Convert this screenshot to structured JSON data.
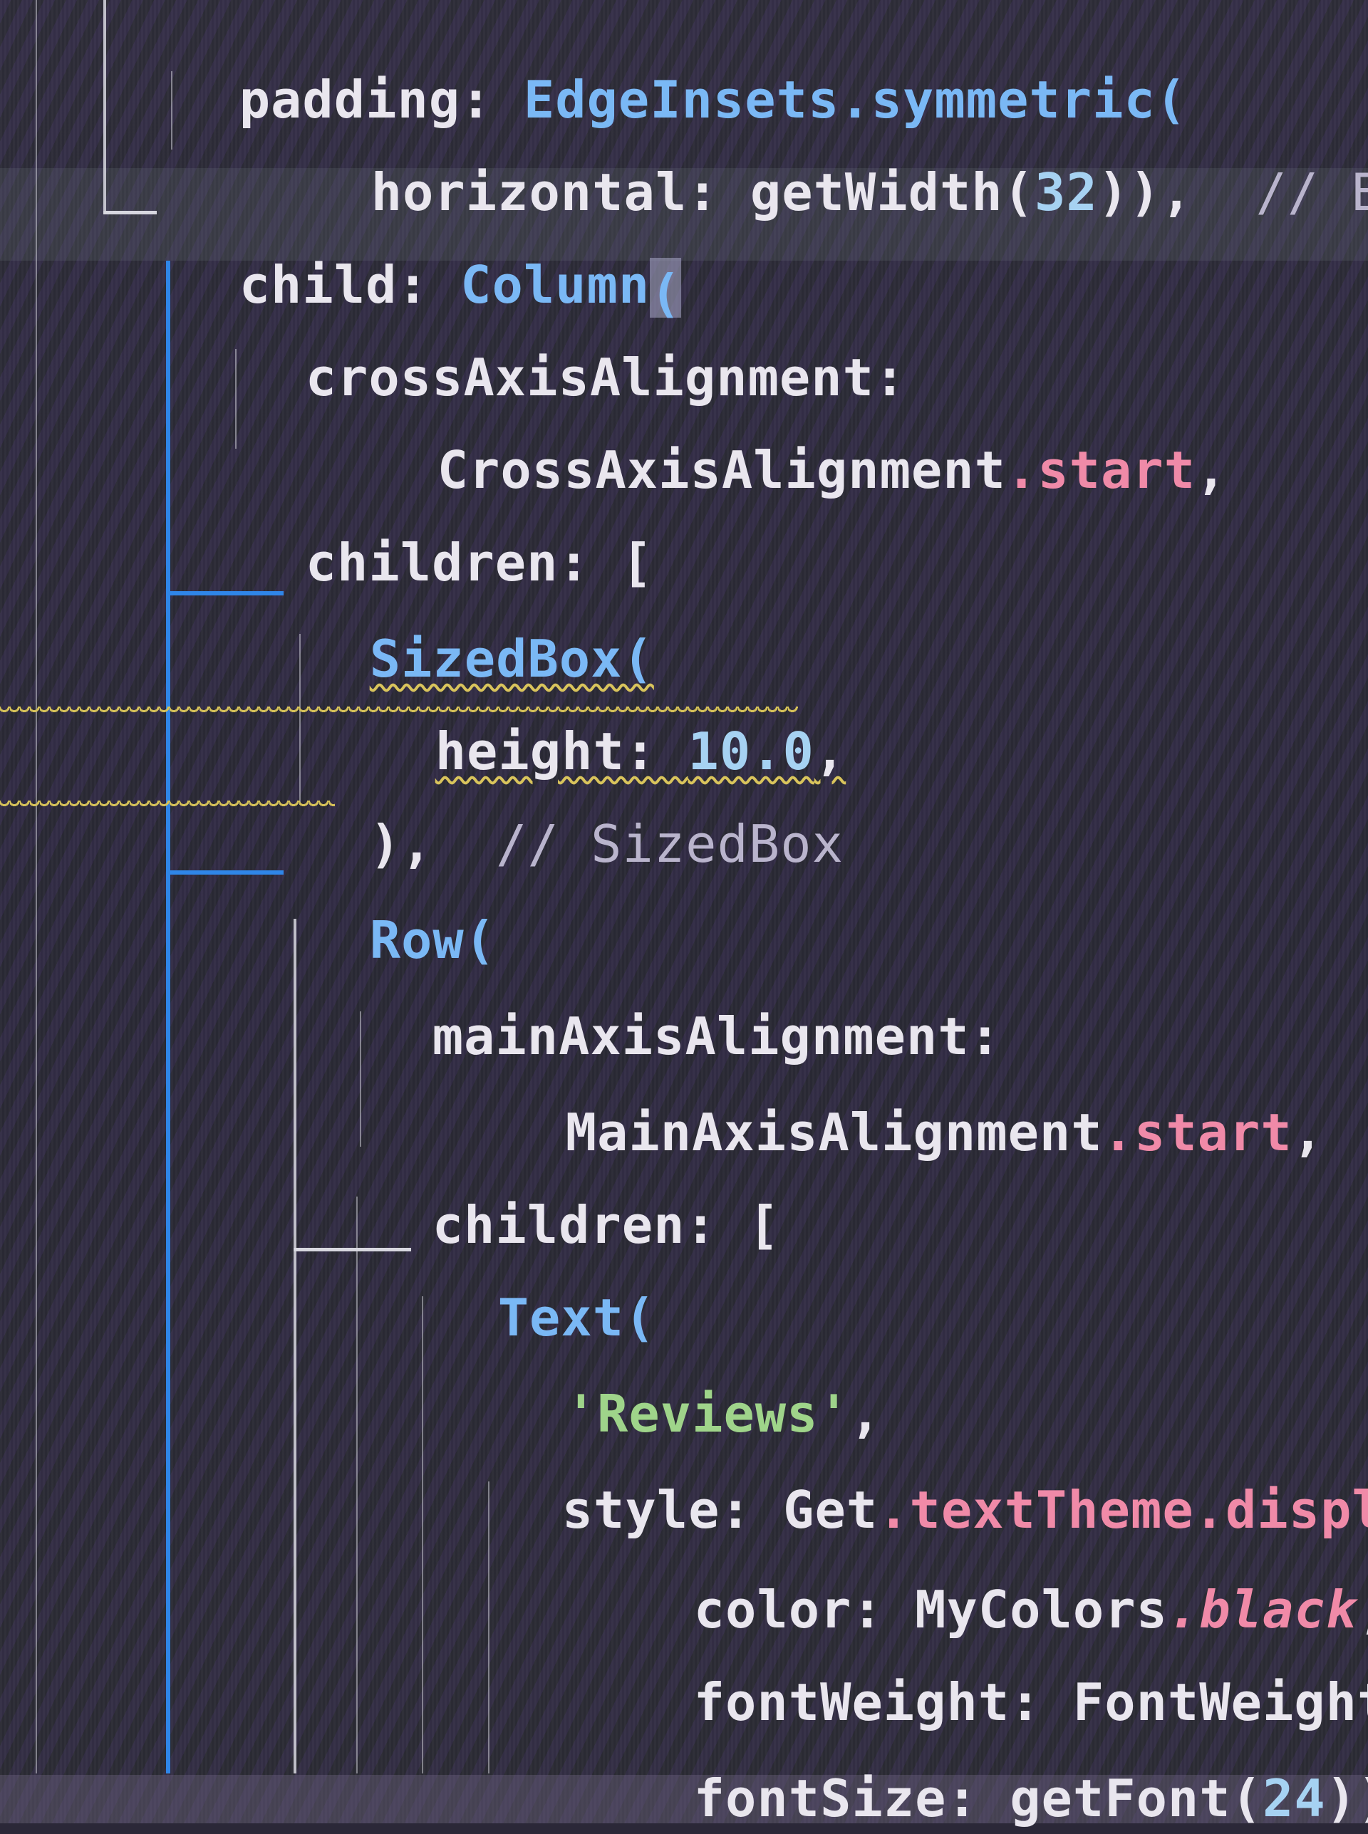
{
  "editor": {
    "language": "dart",
    "current_line_index": 2,
    "colors": {
      "background": "#2b2838",
      "keyword_class": "#7ab8f5",
      "property": "#e9e6ee",
      "number": "#a6d2f2",
      "string": "#9fd48a",
      "field": "#f08aa8",
      "comment": "#b9b4cc",
      "guide_active": "#2f86e8",
      "warning_squiggle": "#d6c259"
    },
    "lines": [
      {
        "tokens": [
          {
            "t": "padding: ",
            "k": "prop"
          },
          {
            "t": "EdgeInsets",
            "k": "class"
          },
          {
            "t": ".symmetric(",
            "k": "class"
          }
        ]
      },
      {
        "tokens": [
          {
            "t": "horizontal: ",
            "k": "prop"
          },
          {
            "t": "getWidth(",
            "k": "fn"
          },
          {
            "t": "32",
            "k": "num"
          },
          {
            "t": ")),  ",
            "k": "fn"
          },
          {
            "t": "// E",
            "k": "comment"
          }
        ]
      },
      {
        "tokens": [
          {
            "t": "child: ",
            "k": "prop"
          },
          {
            "t": "Column",
            "k": "class"
          },
          {
            "t": "(",
            "k": "class"
          }
        ]
      },
      {
        "tokens": [
          {
            "t": "crossAxisAlignment:",
            "k": "prop"
          }
        ]
      },
      {
        "tokens": [
          {
            "t": "CrossAxisAlignment",
            "k": "prop"
          },
          {
            "t": ".start",
            "k": "field"
          },
          {
            "t": ",",
            "k": "prop"
          }
        ]
      },
      {
        "tokens": [
          {
            "t": "children: [",
            "k": "prop"
          }
        ]
      },
      {
        "tokens": [
          {
            "t": "SizedBox(",
            "k": "class"
          }
        ]
      },
      {
        "tokens": [
          {
            "t": "height: ",
            "k": "prop"
          },
          {
            "t": "10.0",
            "k": "num"
          },
          {
            "t": ",",
            "k": "prop"
          }
        ]
      },
      {
        "tokens": [
          {
            "t": "),  ",
            "k": "prop"
          },
          {
            "t": "// SizedBox",
            "k": "comment"
          }
        ]
      },
      {
        "tokens": [
          {
            "t": "Row(",
            "k": "class"
          }
        ]
      },
      {
        "tokens": [
          {
            "t": "mainAxisAlignment:",
            "k": "prop"
          }
        ]
      },
      {
        "tokens": [
          {
            "t": "MainAxisAlignment",
            "k": "prop"
          },
          {
            "t": ".start",
            "k": "field"
          },
          {
            "t": ",",
            "k": "prop"
          }
        ]
      },
      {
        "tokens": [
          {
            "t": "children: [",
            "k": "prop"
          }
        ]
      },
      {
        "tokens": [
          {
            "t": "Text(",
            "k": "class"
          }
        ]
      },
      {
        "tokens": [
          {
            "t": "'Reviews'",
            "k": "string"
          },
          {
            "t": ",",
            "k": "prop"
          }
        ]
      },
      {
        "tokens": [
          {
            "t": "style: ",
            "k": "prop"
          },
          {
            "t": "Get",
            "k": "prop"
          },
          {
            "t": ".textTheme",
            "k": "field"
          },
          {
            "t": ".displ",
            "k": "prop"
          }
        ]
      },
      {
        "tokens": [
          {
            "t": "color: ",
            "k": "prop"
          },
          {
            "t": "MyColors",
            "k": "prop"
          },
          {
            "t": ".black",
            "k": "field-italic"
          },
          {
            "t": ",",
            "k": "prop"
          }
        ]
      },
      {
        "tokens": [
          {
            "t": "fontWeight: ",
            "k": "prop"
          },
          {
            "t": "FontWeight",
            "k": "prop"
          }
        ]
      },
      {
        "tokens": [
          {
            "t": "fontSize: ",
            "k": "prop"
          },
          {
            "t": "getFont(",
            "k": "fn"
          },
          {
            "t": "24",
            "k": "num"
          },
          {
            "t": "))",
            "k": "fn"
          }
        ]
      }
    ]
  }
}
